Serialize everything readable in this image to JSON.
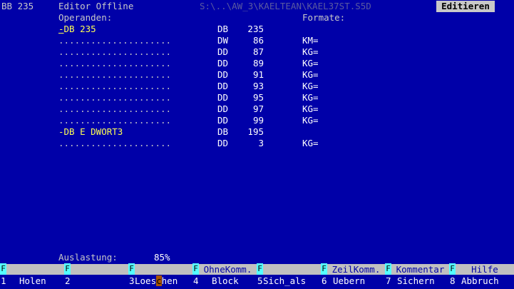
{
  "titlebar": {
    "block": "BB 235",
    "editor": "Editor Offline",
    "path": "S:\\..\\AW_3\\KAELTEAN\\KAEL37ST.S5D",
    "mode": "Editieren"
  },
  "headers": {
    "operands": "Operanden:",
    "formats": "Formate:"
  },
  "rows": [
    {
      "op": "-DB 235",
      "cursor": "-",
      "rest": "DB 235",
      "type": "DB",
      "value": "235",
      "format": "",
      "yellow": true
    },
    {
      "op": ".....................",
      "type": "DW",
      "value": "86",
      "format": "KM="
    },
    {
      "op": ".....................",
      "type": "DD",
      "value": "87",
      "format": "KG="
    },
    {
      "op": ".....................",
      "type": "DD",
      "value": "89",
      "format": "KG="
    },
    {
      "op": ".....................",
      "type": "DD",
      "value": "91",
      "format": "KG="
    },
    {
      "op": ".....................",
      "type": "DD",
      "value": "93",
      "format": "KG="
    },
    {
      "op": ".....................",
      "type": "DD",
      "value": "95",
      "format": "KG="
    },
    {
      "op": ".....................",
      "type": "DD",
      "value": "97",
      "format": "KG="
    },
    {
      "op": ".....................",
      "type": "DD",
      "value": "99",
      "format": "KG="
    },
    {
      "op": "-DB E DWORT3",
      "type": "DB",
      "value": "195",
      "format": "",
      "yellow": true
    },
    {
      "op": ".....................",
      "type": "DD",
      "value": "3",
      "format": "KG="
    }
  ],
  "status": {
    "load_label": "Auslastung:",
    "load_value": "85%"
  },
  "fkeys": [
    {
      "f": "F",
      "label": "",
      "num": "1",
      "caption": "Holen"
    },
    {
      "f": "F",
      "label": "",
      "num": "2",
      "caption": ""
    },
    {
      "f": "F",
      "label": "",
      "num": "3",
      "caption_a": "Loes",
      "caption_b": "c",
      "caption_c": "hen"
    },
    {
      "f": "F",
      "label": "OhneKomm.",
      "num": "4",
      "caption": "Block"
    },
    {
      "f": "F",
      "label": "",
      "num": "5",
      "caption": "Sich_als"
    },
    {
      "f": "F",
      "label": "ZeilKomm.",
      "num": "6",
      "caption": "Uebern"
    },
    {
      "f": "F",
      "label": "Kommentar",
      "num": "7",
      "caption": "Sichern"
    },
    {
      "f": "F",
      "label": "Hilfe",
      "num": "8",
      "caption": "Abbruch"
    }
  ],
  "colors": {
    "background": "#0000a8",
    "operand_highlight": "#ffff54",
    "fkey_marker": "#55ffff",
    "fkey_label_bg": "#c0c0c0"
  }
}
